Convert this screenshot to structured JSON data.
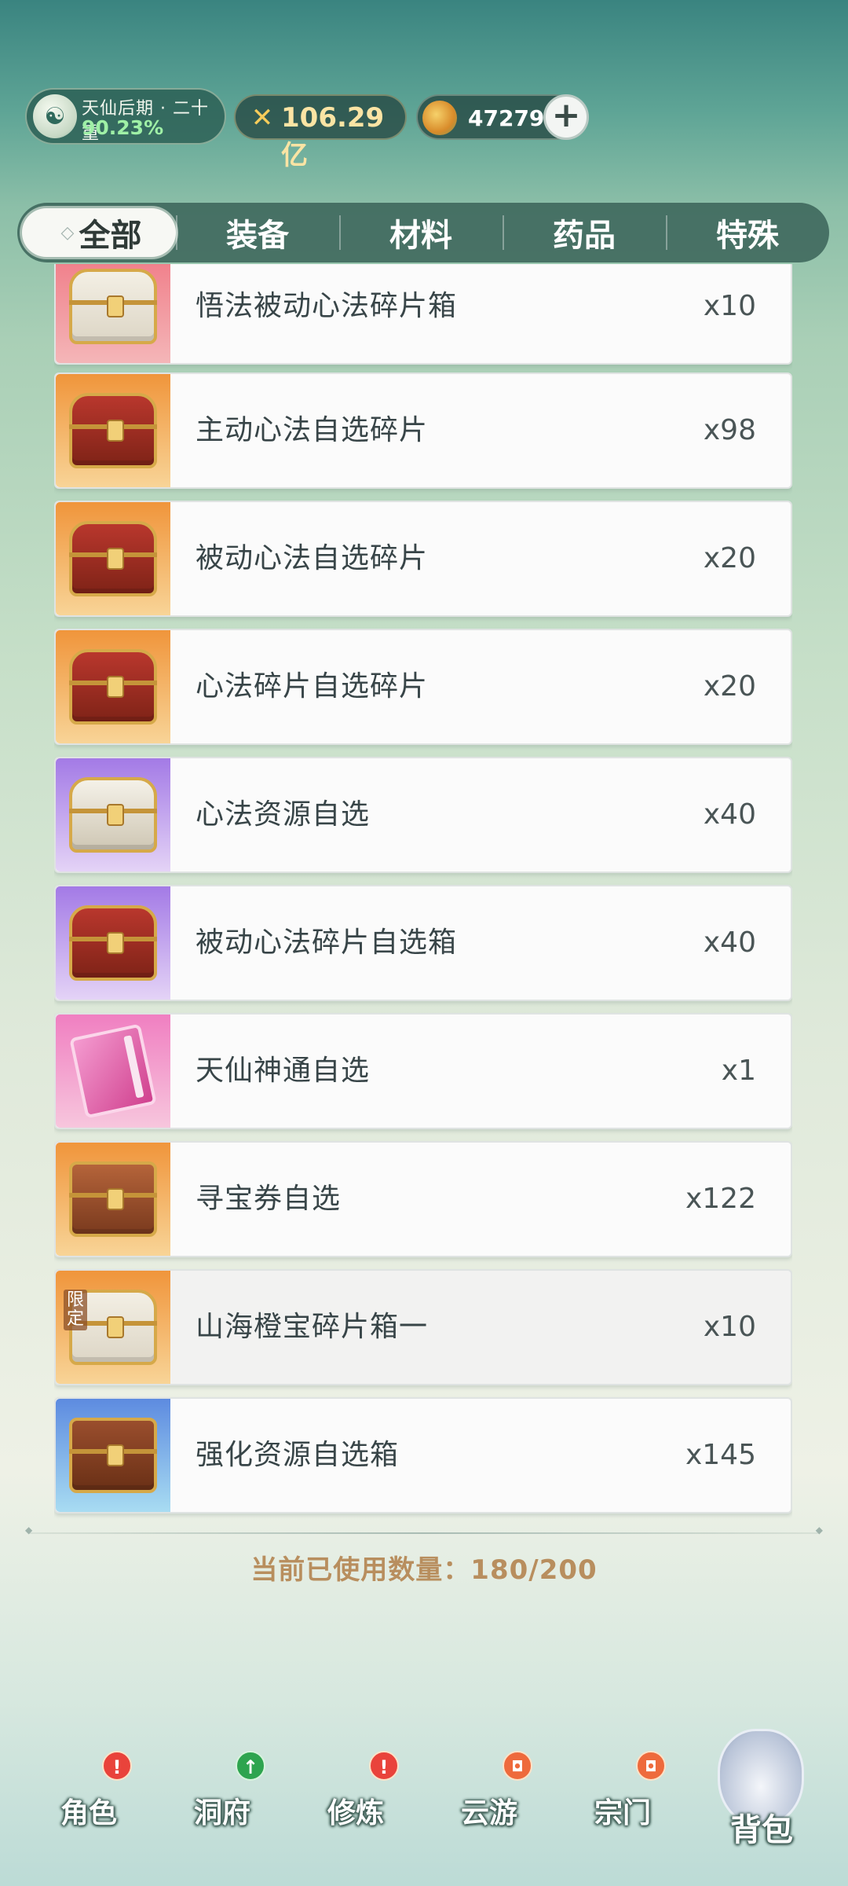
{
  "header": {
    "realm_name": "天仙后期 · 二十重",
    "realm_progress": "90.23%",
    "power_value": "106.29亿",
    "spirit_stones": "47279",
    "add_icon": "plus-icon"
  },
  "tabs": [
    {
      "label": "全部",
      "active": true
    },
    {
      "label": "装备",
      "active": false
    },
    {
      "label": "材料",
      "active": false
    },
    {
      "label": "药品",
      "active": false
    },
    {
      "label": "特殊",
      "active": false
    }
  ],
  "items": [
    {
      "name": "悟法被动心法碎片箱",
      "qty": "x10",
      "bg": "pink",
      "icon": "gold-white-chest-icon"
    },
    {
      "name": "主动心法自选碎片",
      "qty": "x98",
      "bg": "orange",
      "icon": "red-chest-icon"
    },
    {
      "name": "被动心法自选碎片",
      "qty": "x20",
      "bg": "orange",
      "icon": "red-chest-icon"
    },
    {
      "name": "心法碎片自选碎片",
      "qty": "x20",
      "bg": "orange",
      "icon": "red-chest-icon"
    },
    {
      "name": "心法资源自选",
      "qty": "x40",
      "bg": "purple",
      "icon": "white-chest-icon"
    },
    {
      "name": "被动心法碎片自选箱",
      "qty": "x40",
      "bg": "purple",
      "icon": "red-chest-icon"
    },
    {
      "name": "天仙神通自选",
      "qty": "x1",
      "bg": "magenta",
      "icon": "pink-book-icon"
    },
    {
      "name": "寻宝券自选",
      "qty": "x122",
      "bg": "orange",
      "icon": "wooden-chest-icon"
    },
    {
      "name": "山海橙宝碎片箱一",
      "qty": "x10",
      "bg": "orange",
      "icon": "gold-white-chest-icon",
      "tag": "限定"
    },
    {
      "name": "强化资源自选箱",
      "qty": "x145",
      "bg": "blue",
      "icon": "jade-wooden-chest-icon"
    }
  ],
  "capacity_text": "当前已使用数量：180/200",
  "nav": [
    {
      "label": "角色",
      "badge": "!",
      "badge_type": "red"
    },
    {
      "label": "洞府",
      "badge": "↑",
      "badge_type": "green"
    },
    {
      "label": "修炼",
      "badge": "!",
      "badge_type": "red"
    },
    {
      "label": "云游",
      "badge": "◘",
      "badge_type": "orange"
    },
    {
      "label": "宗门",
      "badge": "◘",
      "badge_type": "orange"
    },
    {
      "label": "背包",
      "active": true
    }
  ]
}
